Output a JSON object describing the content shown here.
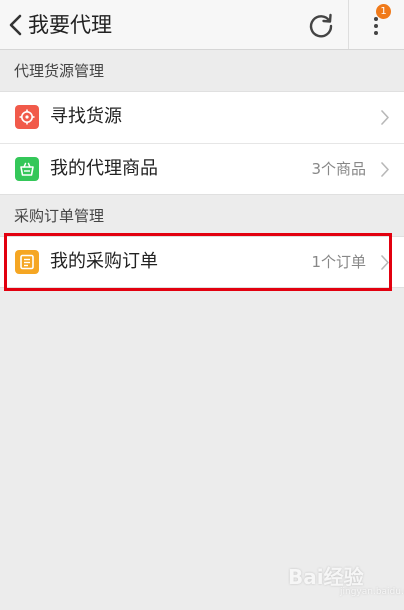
{
  "header": {
    "title": "我要代理",
    "back_icon": "chevron-left-icon",
    "refresh_icon": "refresh-icon",
    "more_icon": "more-vertical-icon",
    "badge_count": "1",
    "badge_color": "#f07a1a"
  },
  "sections": [
    {
      "title": "代理货源管理",
      "items": [
        {
          "label": "寻找货源",
          "count": "",
          "icon": "target-icon",
          "icon_color": "#f15a4a"
        },
        {
          "label": "我的代理商品",
          "count": "3个商品",
          "icon": "basket-icon",
          "icon_color": "#34c759"
        }
      ]
    },
    {
      "title": "采购订单管理",
      "items": [
        {
          "label": "我的采购订单",
          "count": "1个订单",
          "icon": "order-list-icon",
          "icon_color": "#f5a623"
        }
      ]
    }
  ],
  "highlight_color": "#e2000f",
  "watermark": {
    "text": "Bai经验",
    "sub": "jingyan.baidu.com"
  }
}
